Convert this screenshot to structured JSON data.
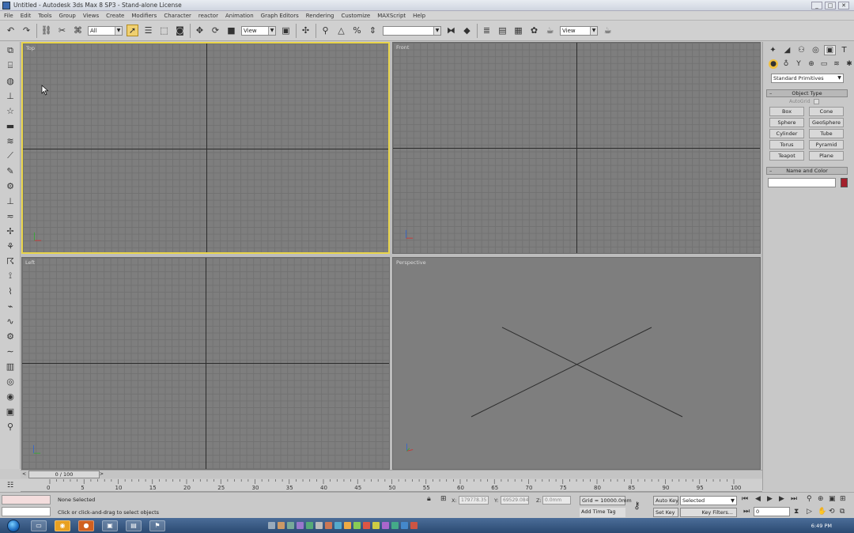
{
  "window": {
    "title": "Untitled - Autodesk 3ds Max 8 SP3 - Stand-alone License",
    "buttons": [
      "_",
      "□",
      "✕"
    ]
  },
  "menu": [
    "File",
    "Edit",
    "Tools",
    "Group",
    "Views",
    "Create",
    "Modifiers",
    "Character",
    "reactor",
    "Animation",
    "Graph Editors",
    "Rendering",
    "Customize",
    "MAXScript",
    "Help"
  ],
  "toolbar": {
    "selection_filter": "All",
    "reference_coord": "View",
    "named_selection": "",
    "render_type": "View"
  },
  "viewports": {
    "top": {
      "label": "Top"
    },
    "front": {
      "label": "Front"
    },
    "left": {
      "label": "Left"
    },
    "perspective": {
      "label": "Perspective"
    }
  },
  "command_panel": {
    "category": "Standard Primitives",
    "object_type_title": "Object Type",
    "autogrid_label": "AutoGrid",
    "primitives": [
      "Box",
      "Cone",
      "Sphere",
      "GeoSphere",
      "Cylinder",
      "Tube",
      "Torus",
      "Pyramid",
      "Teapot",
      "Plane"
    ],
    "name_color_title": "Name and Color",
    "object_color": "#a3202c"
  },
  "time_slider": {
    "position": "0 / 100",
    "left_arrow": "<",
    "right_arrow": ">"
  },
  "ruler": {
    "labels": [
      "0",
      "5",
      "10",
      "15",
      "20",
      "25",
      "30",
      "35",
      "40",
      "45",
      "50",
      "55",
      "60",
      "65",
      "70",
      "75",
      "80",
      "85",
      "90",
      "95",
      "100"
    ]
  },
  "status": {
    "selection": "None Selected",
    "prompt": "Click or click-and-drag to select objects",
    "x_label": "X:",
    "x_value": "179778.35",
    "y_label": "Y:",
    "y_value": "69529.084",
    "z_label": "Z:",
    "z_value": "0.0mm",
    "grid": "Grid = 10000.0mm",
    "add_time_tag": "Add Time Tag",
    "auto_key": "Auto Key",
    "set_key": "Set Key",
    "key_mode_value": "Selected",
    "key_filters": "Key Filters...",
    "current_frame": "0"
  },
  "taskbar": {
    "clock": "6:49 PM"
  }
}
